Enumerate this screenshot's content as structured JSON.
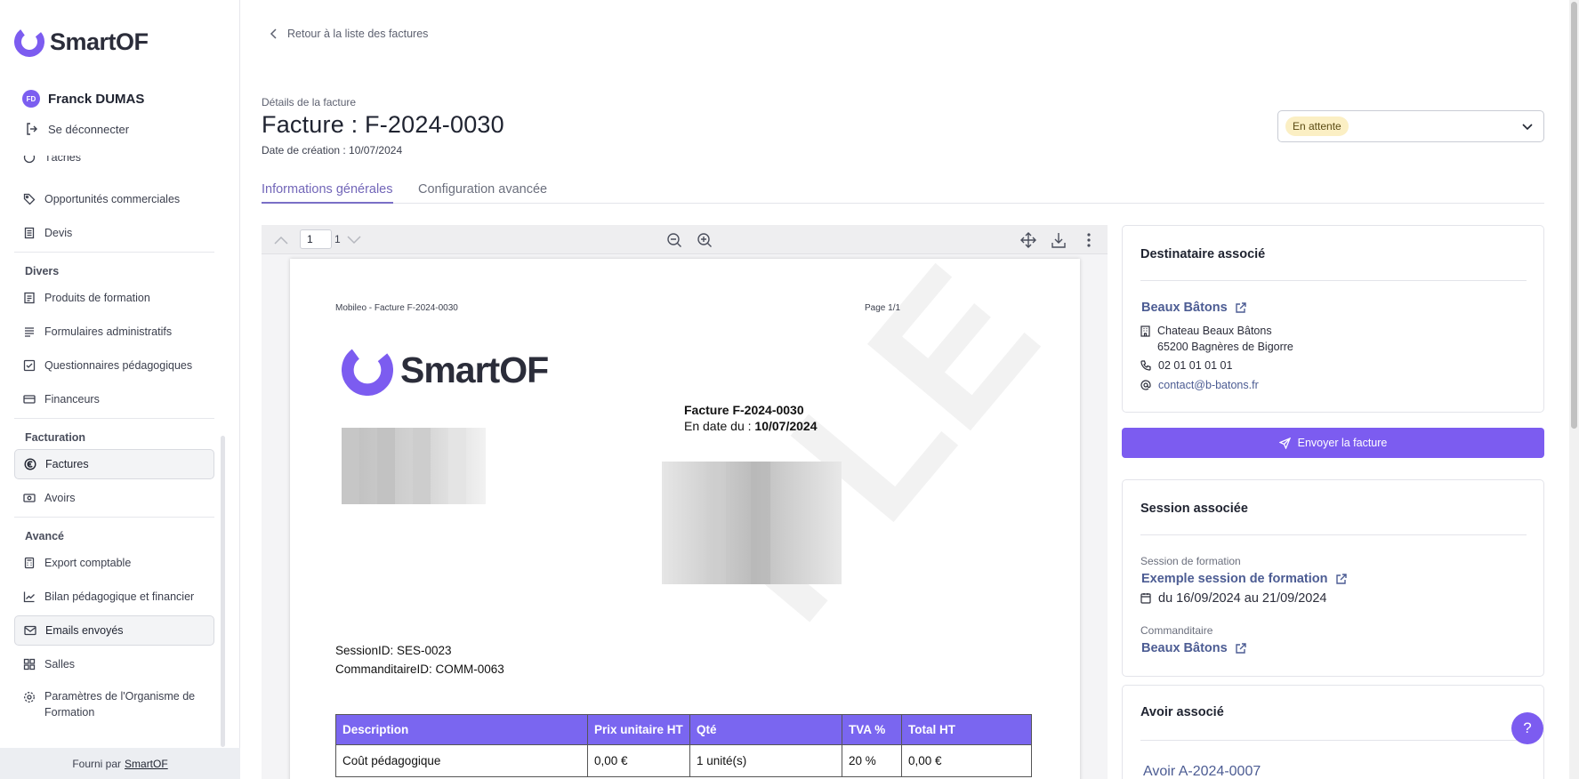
{
  "brand": {
    "name": "SmartOF",
    "accent": "#7c5cf0"
  },
  "user": {
    "initials": "FD",
    "name": "Franck DUMAS",
    "logout_label": "Se déconnecter"
  },
  "nav": {
    "partial_item": "Tâches",
    "opportunites": "Opportunités commerciales",
    "devis": "Devis",
    "section_divers": "Divers",
    "produits": "Produits de formation",
    "formulaires": "Formulaires administratifs",
    "questionnaires": "Questionnaires pédagogiques",
    "financeurs": "Financeurs",
    "section_facturation": "Facturation",
    "factures": "Factures",
    "avoirs": "Avoirs",
    "section_avance": "Avancé",
    "export": "Export comptable",
    "bilan": "Bilan pédagogique et financier",
    "emails": "Emails envoyés",
    "salles": "Salles",
    "parametres": "Paramètres de l'Organisme de Formation"
  },
  "footer": {
    "prefix": "Fourni par",
    "link": "SmartOF"
  },
  "header": {
    "back_label": "Retour à la liste des factures",
    "subtitle": "Détails de la facture",
    "title": "Facture : F-2024-0030",
    "created": "Date de création : 10/07/2024",
    "status": "En attente"
  },
  "tabs": {
    "general": "Informations générales",
    "advanced": "Configuration avancée"
  },
  "viewer": {
    "page_value": "1",
    "page_total": "1",
    "pdf": {
      "header_left": "Mobileo - Facture F-2024-0030",
      "header_right": "Page 1/1",
      "logo_text": "SmartOF",
      "invoice_title": "Facture F-2024-0030",
      "date_prefix": "En date du : ",
      "date_value": "10/07/2024",
      "session_id": "SessionID: SES-0023",
      "commanditaire_id": "CommanditaireID: COMM-0063",
      "watermark": "PLE",
      "table": {
        "headers": [
          "Description",
          "Prix unitaire HT",
          "Qté",
          "TVA %",
          "Total HT"
        ],
        "rows": [
          [
            "Coût pédagogique",
            "0,00 €",
            "1 unité(s)",
            "20 %",
            "0,00 €"
          ]
        ]
      }
    }
  },
  "recipient": {
    "title": "Destinataire associé",
    "name": "Beaux Bâtons",
    "address1": "Chateau Beaux Bâtons",
    "address2": "65200 Bagnères de Bigorre",
    "phone": "02 01 01 01 01",
    "email": "contact@b-batons.fr"
  },
  "send_button": "Envoyer la facture",
  "session": {
    "title": "Session associée",
    "label": "Session de formation",
    "name": "Exemple session de formation",
    "dates": "du 16/09/2024 au 21/09/2024",
    "commanditaire_label": "Commanditaire",
    "commanditaire": "Beaux Bâtons"
  },
  "credit": {
    "title": "Avoir associé",
    "name": "Avoir A-2024-0007"
  },
  "help": "?"
}
